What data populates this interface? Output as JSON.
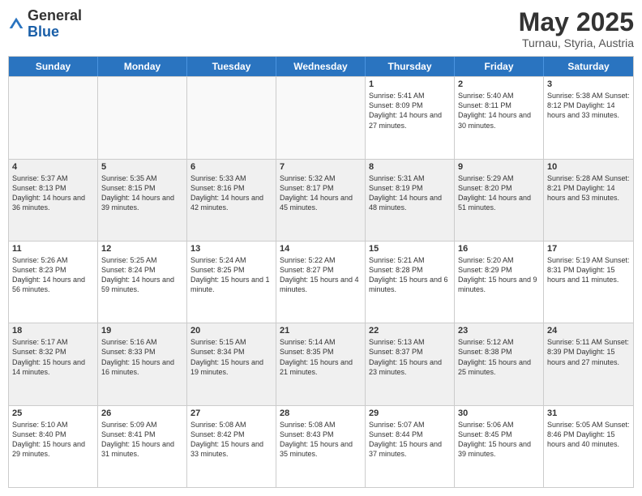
{
  "header": {
    "logo_general": "General",
    "logo_blue": "Blue",
    "month_title": "May 2025",
    "subtitle": "Turnau, Styria, Austria"
  },
  "days_of_week": [
    "Sunday",
    "Monday",
    "Tuesday",
    "Wednesday",
    "Thursday",
    "Friday",
    "Saturday"
  ],
  "rows": [
    [
      {
        "day": "",
        "info": "",
        "empty": true
      },
      {
        "day": "",
        "info": "",
        "empty": true
      },
      {
        "day": "",
        "info": "",
        "empty": true
      },
      {
        "day": "",
        "info": "",
        "empty": true
      },
      {
        "day": "1",
        "info": "Sunrise: 5:41 AM\nSunset: 8:09 PM\nDaylight: 14 hours\nand 27 minutes.",
        "empty": false
      },
      {
        "day": "2",
        "info": "Sunrise: 5:40 AM\nSunset: 8:11 PM\nDaylight: 14 hours\nand 30 minutes.",
        "empty": false
      },
      {
        "day": "3",
        "info": "Sunrise: 5:38 AM\nSunset: 8:12 PM\nDaylight: 14 hours\nand 33 minutes.",
        "empty": false
      }
    ],
    [
      {
        "day": "4",
        "info": "Sunrise: 5:37 AM\nSunset: 8:13 PM\nDaylight: 14 hours\nand 36 minutes.",
        "empty": false
      },
      {
        "day": "5",
        "info": "Sunrise: 5:35 AM\nSunset: 8:15 PM\nDaylight: 14 hours\nand 39 minutes.",
        "empty": false
      },
      {
        "day": "6",
        "info": "Sunrise: 5:33 AM\nSunset: 8:16 PM\nDaylight: 14 hours\nand 42 minutes.",
        "empty": false
      },
      {
        "day": "7",
        "info": "Sunrise: 5:32 AM\nSunset: 8:17 PM\nDaylight: 14 hours\nand 45 minutes.",
        "empty": false
      },
      {
        "day": "8",
        "info": "Sunrise: 5:31 AM\nSunset: 8:19 PM\nDaylight: 14 hours\nand 48 minutes.",
        "empty": false
      },
      {
        "day": "9",
        "info": "Sunrise: 5:29 AM\nSunset: 8:20 PM\nDaylight: 14 hours\nand 51 minutes.",
        "empty": false
      },
      {
        "day": "10",
        "info": "Sunrise: 5:28 AM\nSunset: 8:21 PM\nDaylight: 14 hours\nand 53 minutes.",
        "empty": false
      }
    ],
    [
      {
        "day": "11",
        "info": "Sunrise: 5:26 AM\nSunset: 8:23 PM\nDaylight: 14 hours\nand 56 minutes.",
        "empty": false
      },
      {
        "day": "12",
        "info": "Sunrise: 5:25 AM\nSunset: 8:24 PM\nDaylight: 14 hours\nand 59 minutes.",
        "empty": false
      },
      {
        "day": "13",
        "info": "Sunrise: 5:24 AM\nSunset: 8:25 PM\nDaylight: 15 hours\nand 1 minute.",
        "empty": false
      },
      {
        "day": "14",
        "info": "Sunrise: 5:22 AM\nSunset: 8:27 PM\nDaylight: 15 hours\nand 4 minutes.",
        "empty": false
      },
      {
        "day": "15",
        "info": "Sunrise: 5:21 AM\nSunset: 8:28 PM\nDaylight: 15 hours\nand 6 minutes.",
        "empty": false
      },
      {
        "day": "16",
        "info": "Sunrise: 5:20 AM\nSunset: 8:29 PM\nDaylight: 15 hours\nand 9 minutes.",
        "empty": false
      },
      {
        "day": "17",
        "info": "Sunrise: 5:19 AM\nSunset: 8:31 PM\nDaylight: 15 hours\nand 11 minutes.",
        "empty": false
      }
    ],
    [
      {
        "day": "18",
        "info": "Sunrise: 5:17 AM\nSunset: 8:32 PM\nDaylight: 15 hours\nand 14 minutes.",
        "empty": false
      },
      {
        "day": "19",
        "info": "Sunrise: 5:16 AM\nSunset: 8:33 PM\nDaylight: 15 hours\nand 16 minutes.",
        "empty": false
      },
      {
        "day": "20",
        "info": "Sunrise: 5:15 AM\nSunset: 8:34 PM\nDaylight: 15 hours\nand 19 minutes.",
        "empty": false
      },
      {
        "day": "21",
        "info": "Sunrise: 5:14 AM\nSunset: 8:35 PM\nDaylight: 15 hours\nand 21 minutes.",
        "empty": false
      },
      {
        "day": "22",
        "info": "Sunrise: 5:13 AM\nSunset: 8:37 PM\nDaylight: 15 hours\nand 23 minutes.",
        "empty": false
      },
      {
        "day": "23",
        "info": "Sunrise: 5:12 AM\nSunset: 8:38 PM\nDaylight: 15 hours\nand 25 minutes.",
        "empty": false
      },
      {
        "day": "24",
        "info": "Sunrise: 5:11 AM\nSunset: 8:39 PM\nDaylight: 15 hours\nand 27 minutes.",
        "empty": false
      }
    ],
    [
      {
        "day": "25",
        "info": "Sunrise: 5:10 AM\nSunset: 8:40 PM\nDaylight: 15 hours\nand 29 minutes.",
        "empty": false
      },
      {
        "day": "26",
        "info": "Sunrise: 5:09 AM\nSunset: 8:41 PM\nDaylight: 15 hours\nand 31 minutes.",
        "empty": false
      },
      {
        "day": "27",
        "info": "Sunrise: 5:08 AM\nSunset: 8:42 PM\nDaylight: 15 hours\nand 33 minutes.",
        "empty": false
      },
      {
        "day": "28",
        "info": "Sunrise: 5:08 AM\nSunset: 8:43 PM\nDaylight: 15 hours\nand 35 minutes.",
        "empty": false
      },
      {
        "day": "29",
        "info": "Sunrise: 5:07 AM\nSunset: 8:44 PM\nDaylight: 15 hours\nand 37 minutes.",
        "empty": false
      },
      {
        "day": "30",
        "info": "Sunrise: 5:06 AM\nSunset: 8:45 PM\nDaylight: 15 hours\nand 39 minutes.",
        "empty": false
      },
      {
        "day": "31",
        "info": "Sunrise: 5:05 AM\nSunset: 8:46 PM\nDaylight: 15 hours\nand 40 minutes.",
        "empty": false
      }
    ]
  ]
}
